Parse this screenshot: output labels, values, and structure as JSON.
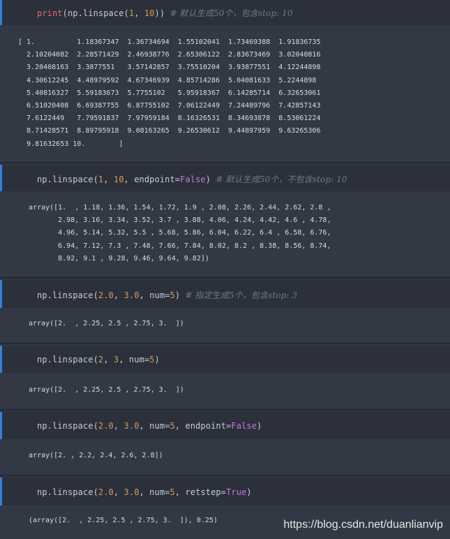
{
  "cells": [
    {
      "code_parts": [
        {
          "t": "print",
          "c": "fn"
        },
        {
          "t": "(np.linspace(",
          "c": ""
        },
        {
          "t": "1",
          "c": "num"
        },
        {
          "t": ", ",
          "c": ""
        },
        {
          "t": "10",
          "c": "num"
        },
        {
          "t": ")) ",
          "c": ""
        },
        {
          "t": "# 默认生成50个，包含stop: 10",
          "c": "cm"
        }
      ],
      "output": "[ 1.          1.18367347  1.36734694  1.55102041  1.73469388  1.91836735\n  2.10204082  2.28571429  2.46938776  2.65306122  2.83673469  3.02040816\n  3.20408163  3.3877551   3.57142857  3.75510204  3.93877551  4.12244898\n  4.30612245  4.48979592  4.67346939  4.85714286  5.04081633  5.2244898\n  5.40816327  5.59183673  5.7755102   5.95918367  6.14285714  6.32653061\n  6.51020408  6.69387755  6.87755102  7.06122449  7.24489796  7.42857143\n  7.6122449   7.79591837  7.97959184  8.16326531  8.34693878  8.53061224\n  8.71428571  8.89795918  9.08163265  9.26530612  9.44897959  9.63265306\n  9.81632653 10.        ]"
    },
    {
      "code_parts": [
        {
          "t": "np.linspace(",
          "c": ""
        },
        {
          "t": "1",
          "c": "num"
        },
        {
          "t": ", ",
          "c": ""
        },
        {
          "t": "10",
          "c": "num"
        },
        {
          "t": ", endpoint=",
          "c": ""
        },
        {
          "t": "False",
          "c": "kw"
        },
        {
          "t": ") ",
          "c": ""
        },
        {
          "t": "# 默认生成50个，不包含stop: 10",
          "c": "cm"
        }
      ],
      "output": "array([1.  , 1.18, 1.36, 1.54, 1.72, 1.9 , 2.08, 2.26, 2.44, 2.62, 2.8 ,\n       2.98, 3.16, 3.34, 3.52, 3.7 , 3.88, 4.06, 4.24, 4.42, 4.6 , 4.78,\n       4.96, 5.14, 5.32, 5.5 , 5.68, 5.86, 6.04, 6.22, 6.4 , 6.58, 6.76,\n       6.94, 7.12, 7.3 , 7.48, 7.66, 7.84, 8.02, 8.2 , 8.38, 8.56, 8.74,\n       8.92, 9.1 , 9.28, 9.46, 9.64, 9.82])"
    },
    {
      "code_parts": [
        {
          "t": "np.linspace(",
          "c": ""
        },
        {
          "t": "2.0",
          "c": "num"
        },
        {
          "t": ", ",
          "c": ""
        },
        {
          "t": "3.0",
          "c": "num"
        },
        {
          "t": ", num=",
          "c": ""
        },
        {
          "t": "5",
          "c": "num"
        },
        {
          "t": ") ",
          "c": ""
        },
        {
          "t": "# 指定生成5个，包含stop: 3",
          "c": "cm"
        }
      ],
      "output": "array([2.  , 2.25, 2.5 , 2.75, 3.  ])"
    },
    {
      "code_parts": [
        {
          "t": "np.linspace(",
          "c": ""
        },
        {
          "t": "2",
          "c": "num"
        },
        {
          "t": ", ",
          "c": ""
        },
        {
          "t": "3",
          "c": "num"
        },
        {
          "t": ", num=",
          "c": ""
        },
        {
          "t": "5",
          "c": "num"
        },
        {
          "t": ")",
          "c": ""
        }
      ],
      "output": "array([2.  , 2.25, 2.5 , 2.75, 3.  ])"
    },
    {
      "code_parts": [
        {
          "t": "np.linspace(",
          "c": ""
        },
        {
          "t": "2.0",
          "c": "num"
        },
        {
          "t": ", ",
          "c": ""
        },
        {
          "t": "3.0",
          "c": "num"
        },
        {
          "t": ", num=",
          "c": ""
        },
        {
          "t": "5",
          "c": "num"
        },
        {
          "t": ", endpoint=",
          "c": ""
        },
        {
          "t": "False",
          "c": "kw"
        },
        {
          "t": ")",
          "c": ""
        }
      ],
      "output": "array([2. , 2.2, 2.4, 2.6, 2.8])"
    },
    {
      "code_parts": [
        {
          "t": "np.linspace(",
          "c": ""
        },
        {
          "t": "2.0",
          "c": "num"
        },
        {
          "t": ", ",
          "c": ""
        },
        {
          "t": "3.0",
          "c": "num"
        },
        {
          "t": ", num=",
          "c": ""
        },
        {
          "t": "5",
          "c": "num"
        },
        {
          "t": ", retstep=",
          "c": ""
        },
        {
          "t": "True",
          "c": "kw"
        },
        {
          "t": ")",
          "c": ""
        }
      ],
      "output": "(array([2.  , 2.25, 2.5 , 2.75, 3.  ]), 0.25)"
    }
  ],
  "watermark": "https://blog.csdn.net/duanlianvip",
  "colors": {
    "background": "#323844",
    "input_background": "#2b303a",
    "rail": "#3c7fd0",
    "function": "#e06c75",
    "number": "#d19a66",
    "keyword": "#c678dd",
    "comment": "#6e7a8e"
  }
}
